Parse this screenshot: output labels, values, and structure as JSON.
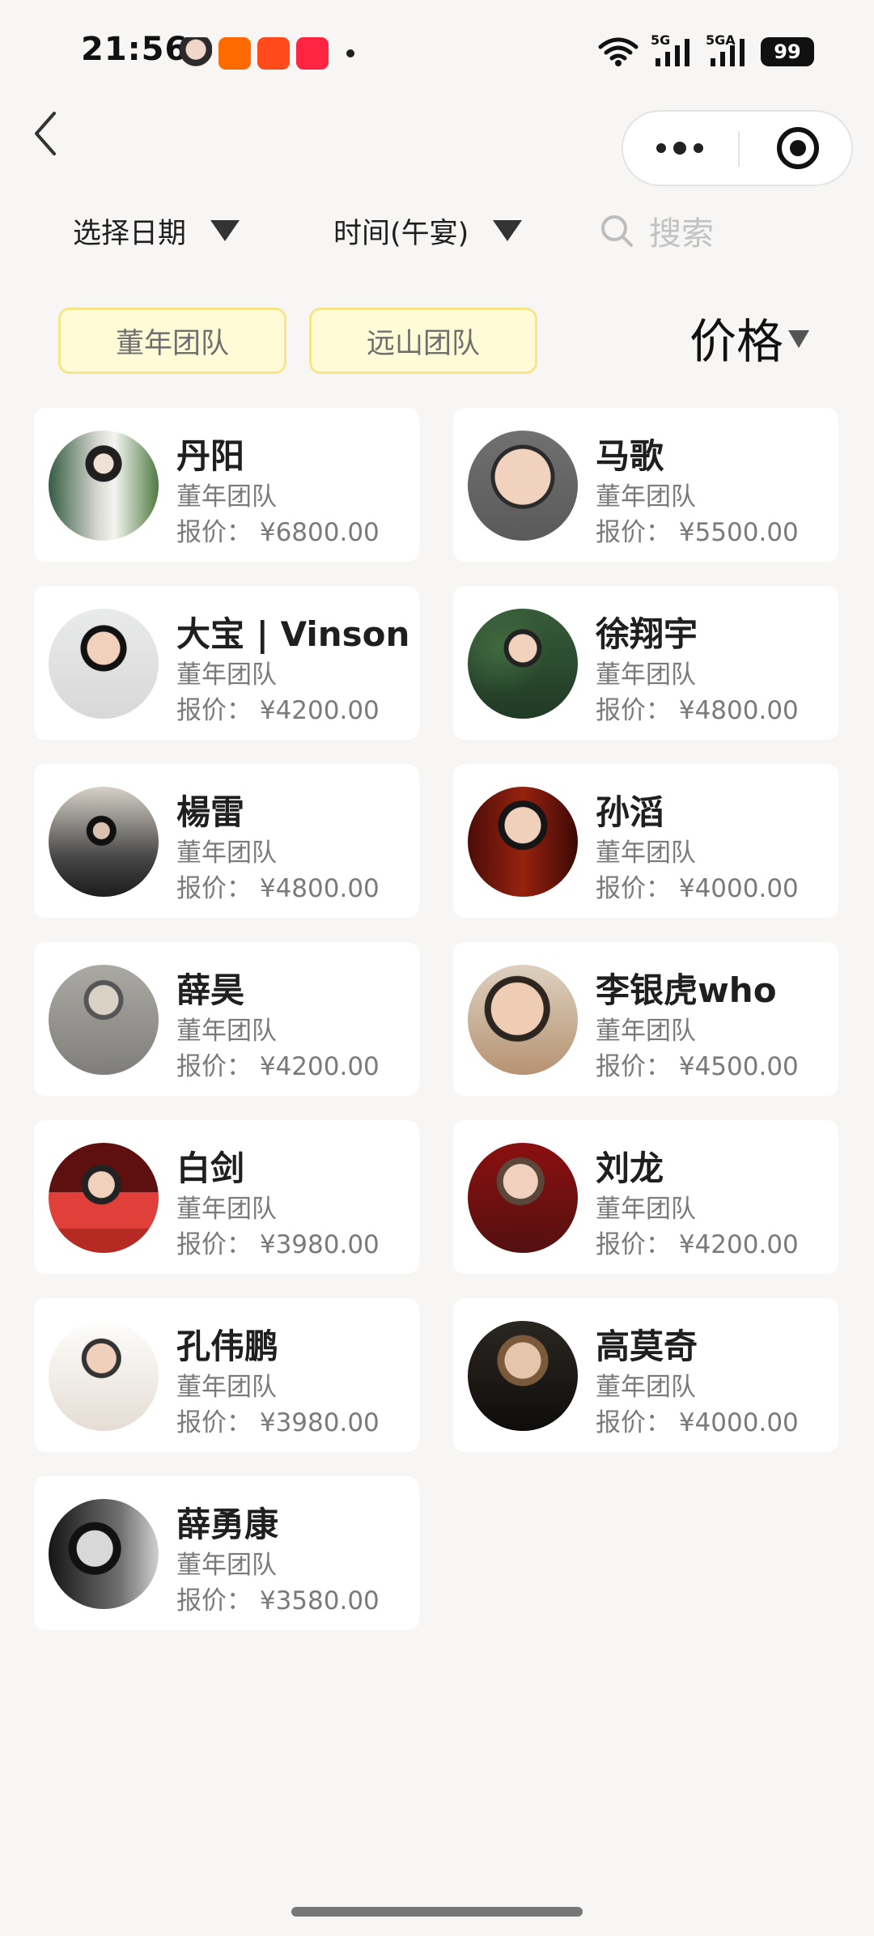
{
  "status_bar": {
    "time": "21:56",
    "network_5g": "5G",
    "network_5ga": "5GA",
    "battery": "99",
    "apps": [
      "portrait-app-icon",
      "kuaishou-app-icon",
      "taobao-app-icon",
      "xiaohongshu-app-icon"
    ]
  },
  "header": {
    "back_icon": "chevron-left-icon",
    "more_icon": "more-dots-icon",
    "close_icon": "target-icon"
  },
  "filters": {
    "date": "选择日期",
    "time": "时间(午宴)",
    "search_placeholder": "搜索"
  },
  "teams": {
    "dongnian": "董年团队",
    "yuanshan": "远山团队"
  },
  "sort": {
    "label": "价格"
  },
  "performers": [
    {
      "name": "丹阳",
      "team": "董年团队",
      "price_label": "报价： ¥6800.00"
    },
    {
      "name": "马歌",
      "team": "董年团队",
      "price_label": "报价： ¥5500.00"
    },
    {
      "name": "大宝 | Vinson",
      "team": "董年团队",
      "price_label": "报价： ¥4200.00"
    },
    {
      "name": "徐翔宇",
      "team": "董年团队",
      "price_label": "报价： ¥4800.00"
    },
    {
      "name": "楊雷",
      "team": "董年团队",
      "price_label": "报价： ¥4800.00"
    },
    {
      "name": "孙滔",
      "team": "董年团队",
      "price_label": "报价： ¥4000.00"
    },
    {
      "name": "薛昊",
      "team": "董年团队",
      "price_label": "报价： ¥4200.00"
    },
    {
      "name": "李银虎who",
      "team": "董年团队",
      "price_label": "报价： ¥4500.00"
    },
    {
      "name": "白剑",
      "team": "董年团队",
      "price_label": "报价： ¥3980.00"
    },
    {
      "name": "刘龙",
      "team": "董年团队",
      "price_label": "报价： ¥4200.00"
    },
    {
      "name": "孔伟鹏",
      "team": "董年团队",
      "price_label": "报价： ¥3980.00"
    },
    {
      "name": "高莫奇",
      "team": "董年团队",
      "price_label": "报价： ¥4000.00"
    },
    {
      "name": "薛勇康",
      "team": "董年团队",
      "price_label": "报价： ¥3580.00"
    }
  ]
}
